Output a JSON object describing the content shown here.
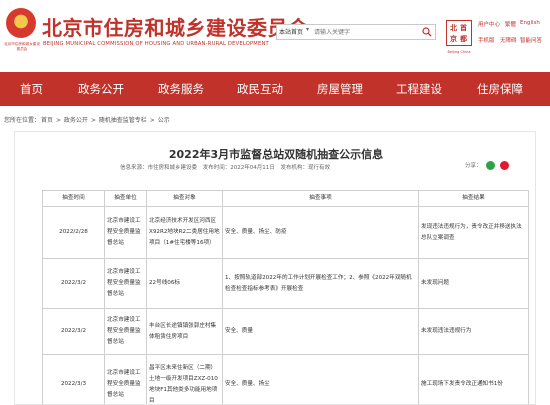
{
  "header": {
    "emblem_caption": "北京市住房和城乡建设委员会",
    "title": "北京市住房和城乡建设委员会",
    "subtitle": "BEIJING MUNICIPAL COMMISSION OF HOUSING AND URBAN-RURAL DEVELOPMENT",
    "search": {
      "scope": "本站首页",
      "placeholder": "请输入关键字"
    },
    "stamp_chars": [
      "北",
      "京",
      "首",
      "都"
    ],
    "stamp_caption": "Beijing China",
    "links": [
      "用户中心",
      "繁體",
      "English",
      "手机版",
      "无障碍",
      "智能问答"
    ]
  },
  "nav": [
    "首页",
    "政务公开",
    "政务服务",
    "政民互动",
    "房屋管理",
    "工程建设",
    "住房保障"
  ],
  "breadcrumb": {
    "prefix": "您所在位置：",
    "items": [
      "首页",
      "政务公开",
      "随机抽查监管专栏",
      "公示"
    ],
    "separator": ">"
  },
  "article": {
    "title": "2022年3月市监督总站双随机抽查公示信息",
    "meta": {
      "source": "信息来源：市住房和城乡建设委",
      "date": "发布时间：2022年04月11日",
      "author": "发布机构：现行有效"
    },
    "share_label": "分享："
  },
  "table": {
    "headers": [
      "抽查时间",
      "抽查单位",
      "抽查对象",
      "抽查事项",
      "抽查结果"
    ],
    "rows": [
      {
        "time": "2022/2/28",
        "unit": "北京市建设工程安全质量监督总站",
        "object": "北京经济技术开发区河西区X92R2地块R2二类居住用地项目（1#住宅楼等16项）",
        "items": "安全、质量、扬尘、防疫",
        "result": "发现违法违规行为，责令改正并移送执法总队立案调查"
      },
      {
        "time": "2022/3/2",
        "unit": "北京市建设工程安全质量监督总站",
        "object": "22号线06标",
        "items": "1、按照轨道部2022年的工作计划开展检查工作；2、参照《2022年双随机检查检查指标参考表》开展检查",
        "result": "未发现问题"
      },
      {
        "time": "2022/3/2",
        "unit": "北京市建设工程安全质量监督总站",
        "object": "丰台区长途镇镇张郭庄村集体租赁住房项目",
        "items": "安全、质量",
        "result": "未发现违法违规行为"
      },
      {
        "time": "2022/3/3",
        "unit": "北京市建设工程安全质量监督总站",
        "object": "昌平区未来住新区（二期）土地一级开发项目ZXZ-010地块F1其他类多功能用地项目",
        "items": "安全、质量、扬尘",
        "result": "施工现场下发责令改正通知书1份"
      }
    ]
  },
  "colors": {
    "brand_red": "#c0322a",
    "nav_text": "#ffffff",
    "border": "#cfcfcf"
  },
  "icons": [
    "national-emblem-icon",
    "search-icon",
    "capital-stamp-icon",
    "wechat-share-icon",
    "weibo-share-icon"
  ]
}
